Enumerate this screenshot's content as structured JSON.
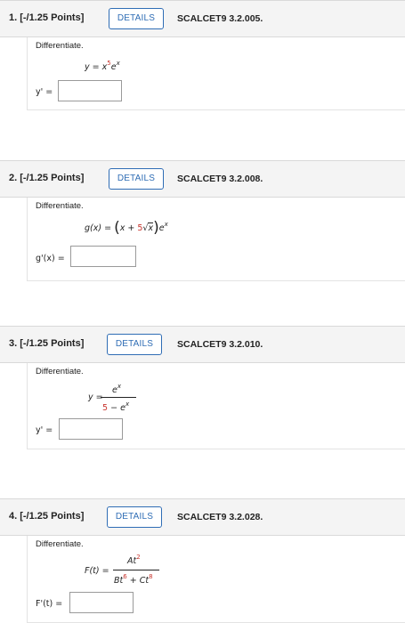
{
  "questions": [
    {
      "title": "1. [-/1.25 Points]",
      "details_label": "DETAILS",
      "code": "SCALCET9 3.2.005.",
      "prompt": "Differentiate.",
      "answer_label": "y' ="
    },
    {
      "title": "2. [-/1.25 Points]",
      "details_label": "DETAILS",
      "code": "SCALCET9 3.2.008.",
      "prompt": "Differentiate.",
      "answer_label": "g'(x) ="
    },
    {
      "title": "3. [-/1.25 Points]",
      "details_label": "DETAILS",
      "code": "SCALCET9 3.2.010.",
      "prompt": "Differentiate.",
      "answer_label": "y' ="
    },
    {
      "title": "4. [-/1.25 Points]",
      "details_label": "DETAILS",
      "code": "SCALCET9 3.2.028.",
      "prompt": "Differentiate.",
      "answer_label": "F'(t) ="
    }
  ],
  "equations": {
    "q1": {
      "lhs": "y =",
      "base": "x",
      "exp": "5",
      "tail": "e",
      "tail_exp": "x"
    },
    "q2": {
      "lhs": "g(x) =",
      "x": "x",
      "plus": "+",
      "coef": "5",
      "radicand": "x",
      "e": "e",
      "e_exp": "x"
    },
    "q3": {
      "lhs": "y =",
      "num": "e",
      "num_exp": "x",
      "den_const": "5",
      "den_minus": "−",
      "den_e": "e",
      "den_exp": "x"
    },
    "q4": {
      "lhs": "F(t) =",
      "num_coef": "A",
      "num_var": "t",
      "num_exp": "2",
      "den_b": "B",
      "den_t1": "t",
      "den_exp1": "6",
      "den_plus": "+",
      "den_c": "C",
      "den_t2": "t",
      "den_exp2": "8"
    }
  },
  "inputs": {
    "q1_value": "",
    "q2_value": "",
    "q3_value": "",
    "q4_value": ""
  },
  "colors": {
    "accent": "#2f6db5",
    "highlight": "#c8352e",
    "header_bg": "#f4f4f4"
  }
}
